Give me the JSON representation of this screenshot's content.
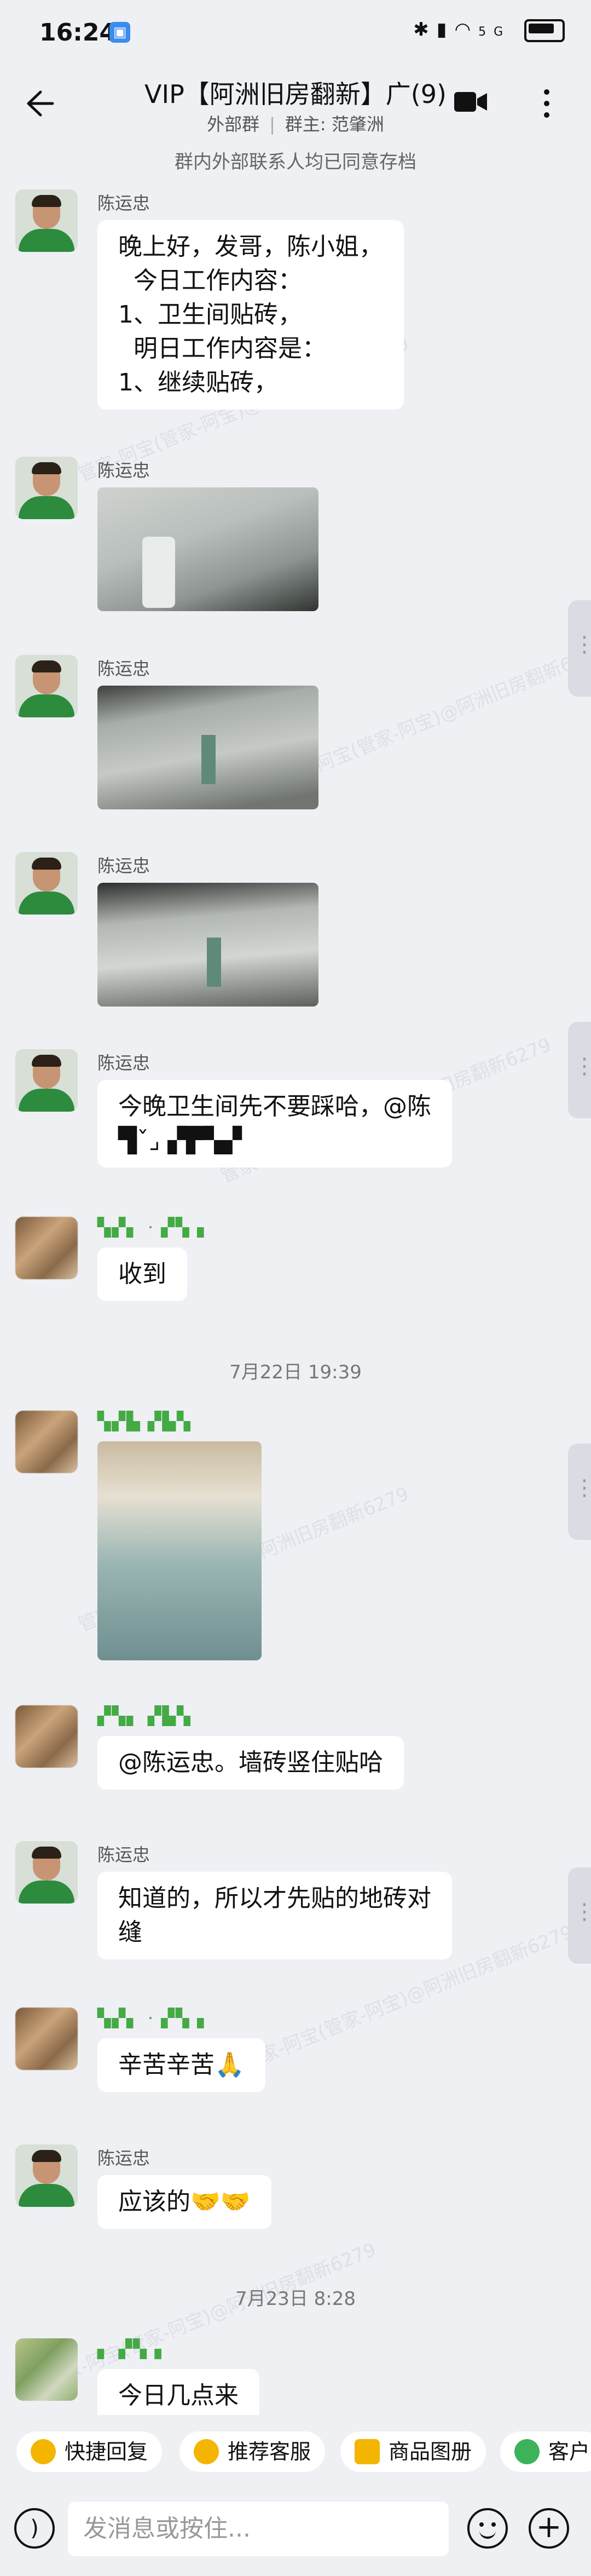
{
  "status_bar": {
    "time": "16:24",
    "signal": "5G",
    "icons": "✱ ▮ ◠ "
  },
  "header": {
    "title": "VIP【阿洲旧房翻新】广(9)",
    "subtitle_left": "外部群",
    "subtitle_right": "群主: 范肇洲",
    "subtitle_sep": "|"
  },
  "notice": "群内外部联系人均已同意存档",
  "messages": [
    {
      "sender": "陈运忠",
      "text": "晚上好，发哥，陈小姐，\n  今日工作内容：\n1、卫生间贴砖，\n  明日工作内容是：\n1、继续贴砖，",
      "type": "text"
    },
    {
      "sender": "陈运忠",
      "type": "image"
    },
    {
      "sender": "陈运忠",
      "type": "image"
    },
    {
      "sender": "陈运忠",
      "type": "image"
    },
    {
      "sender": "陈运忠",
      "text": "今晚卫生间先不要踩哈，@陈\n▜ˇ⌟ ▞▛▚▞",
      "type": "text"
    },
    {
      "sender": "▚▞▖ · ▞▚▗",
      "text": "收到",
      "type": "text"
    },
    {
      "sender": "▚▞▙ ▞▙▚",
      "type": "image"
    },
    {
      "sender": "▞▚▖ ▞▙▚",
      "text": "@陈运忠。墙砖竖住贴哈",
      "type": "text"
    },
    {
      "sender": "陈运忠",
      "text": "知道的，所以才先贴的地砖对\n缝",
      "type": "text"
    },
    {
      "sender": "▚▞▖ · ▞▚▗",
      "text": "辛苦辛苦🙏",
      "type": "text"
    },
    {
      "sender": "陈运忠",
      "text": "应该的🤝🤝",
      "type": "text"
    },
    {
      "sender": "▖ ▞▚▗",
      "text": "今日几点来",
      "type": "text"
    }
  ],
  "time_separators": [
    "7月22日  19:39",
    "7月23日  8:28"
  ],
  "watermark": "管家-阿宝(管家-阿宝)@阿洲旧房翻新6279",
  "quick_actions": [
    {
      "label": "快捷回复",
      "color": "#f3b500"
    },
    {
      "label": "推荐客服",
      "color": "#f3b500"
    },
    {
      "label": "商品图册",
      "color": "#f3b500"
    },
    {
      "label": "客户",
      "color": "#3cb35a"
    }
  ],
  "input": {
    "placeholder": "发消息或按住..."
  },
  "colors": {
    "background": "#eef0f4",
    "bubble": "#ffffff",
    "accent": "#3a8cf0"
  }
}
